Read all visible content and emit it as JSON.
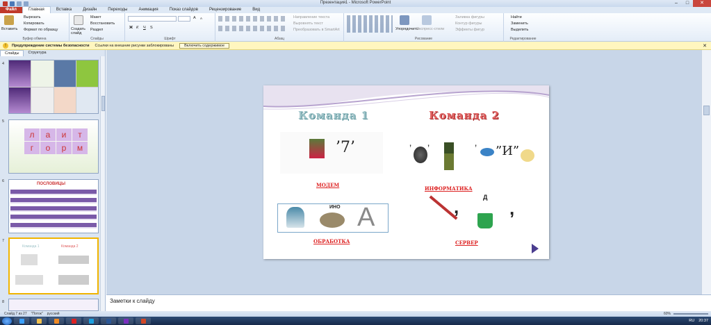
{
  "window": {
    "title": "Презентация1 - Microsoft PowerPoint"
  },
  "tabs": [
    "Файл",
    "Главная",
    "Вставка",
    "Дизайн",
    "Переходы",
    "Анимация",
    "Показ слайдов",
    "Рецензирование",
    "Вид"
  ],
  "ribbon": {
    "clipboard": {
      "paste": "Вставить",
      "cut": "Вырезать",
      "copy": "Копировать",
      "format_painter": "Формат по образцу",
      "label": "Буфер обмена"
    },
    "slides": {
      "new_slide": "Создать слайд",
      "layout": "Макет",
      "reset": "Восстановить",
      "section": "Раздел",
      "label": "Слайды"
    },
    "font": {
      "label": "Шрифт",
      "bold": "Ж",
      "italic": "К",
      "underline": "Ч",
      "strike": "S",
      "size_up": "A",
      "size_down": "A"
    },
    "paragraph": {
      "text_direction": "Направление текста",
      "align_text": "Выровнять текст",
      "smartart": "Преобразовать в SmartArt",
      "label": "Абзац"
    },
    "drawing": {
      "arrange": "Упорядочить",
      "quick_styles": "Экспресс-стили",
      "fill": "Заливка фигуры",
      "outline": "Контур фигуры",
      "effects": "Эффекты фигур",
      "label": "Рисование"
    },
    "editing": {
      "find": "Найти",
      "replace": "Заменить",
      "select": "Выделить",
      "label": "Редактирование"
    }
  },
  "security_bar": {
    "title": "Предупреждение системы безопасности",
    "message": "Ссылки на внешние рисунки заблокированы",
    "button": "Включить содержимое"
  },
  "left_pane": {
    "tabs": [
      "Слайды",
      "Структура"
    ],
    "slide_numbers": [
      "4",
      "5",
      "6",
      "7",
      "8"
    ],
    "thumb5": {
      "letters_top": [
        "л",
        "а",
        "и",
        "т"
      ],
      "letters_bottom": [
        "г",
        "о",
        "р",
        "м"
      ]
    },
    "thumb6": {
      "title": "ПОСЛОВИЦЫ"
    }
  },
  "slide": {
    "team1": "Команда 1",
    "team2": "Команда 2",
    "answers": [
      "МОДЕМ",
      "ИНФОРМАТИКА",
      "ОБРАБОТКА",
      "СЕРВЕР"
    ],
    "rebus_text": {
      "seven": "’7’",
      "q1_left": "’",
      "q1_mid": "’",
      "q1_right": "’",
      "i_quote": "”И”",
      "ino": "ИНО",
      "letter_a": "A",
      "comma1": ",",
      "d_letter": "Д",
      "comma2": ","
    }
  },
  "notes": {
    "placeholder": "Заметки к слайду"
  },
  "status": {
    "slide": "Слайд 7 из 27",
    "theme": "\"Поток\"",
    "lang": "русский",
    "zoom": "60%"
  },
  "tray": {
    "lang": "RU",
    "time": "20:37"
  },
  "colors": {
    "file_tab": "#c0392b",
    "team1": "#9fc4c9",
    "team2": "#e06060",
    "answer": "#dd2222"
  }
}
